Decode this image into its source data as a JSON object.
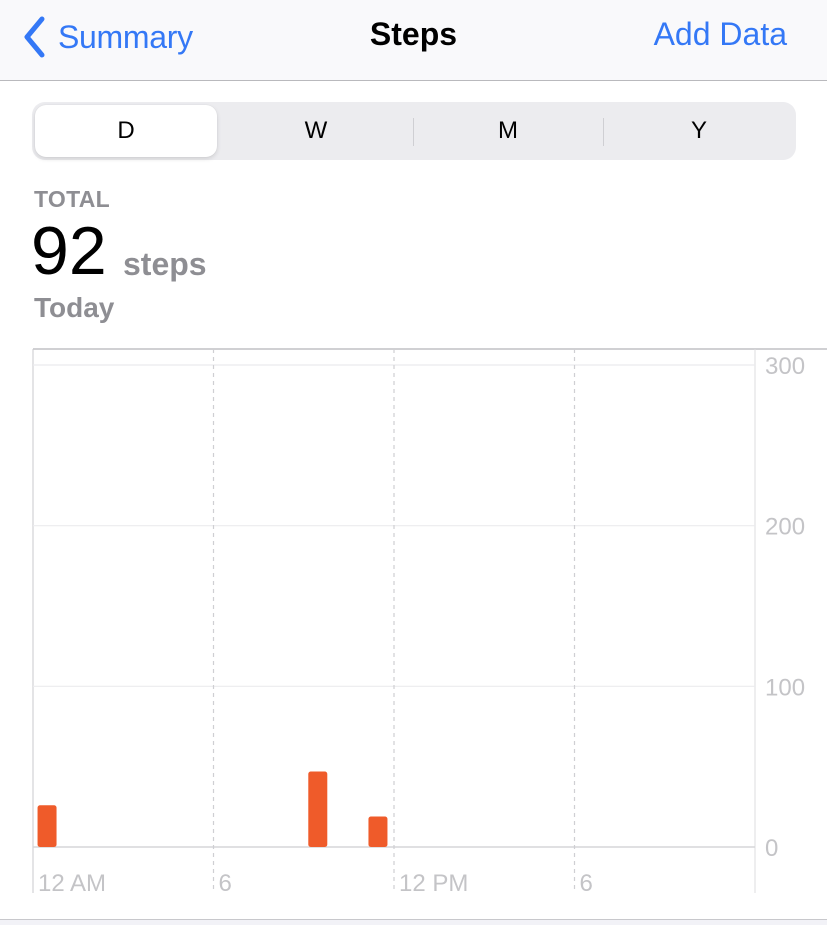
{
  "navbar": {
    "back_label": "Summary",
    "title": "Steps",
    "action_label": "Add Data",
    "accent_color": "#3478f6"
  },
  "segments": {
    "items": [
      "D",
      "W",
      "M",
      "Y"
    ],
    "selected": "D"
  },
  "summary": {
    "label": "TOTAL",
    "value": "92",
    "unit": "steps",
    "period": "Today"
  },
  "chart_data": {
    "type": "bar",
    "title": "",
    "xlabel": "",
    "ylabel": "",
    "x_domain_hours": [
      0,
      24
    ],
    "x_ticks": [
      {
        "hour": 0,
        "label": "12 AM"
      },
      {
        "hour": 6,
        "label": "6"
      },
      {
        "hour": 12,
        "label": "12 PM"
      },
      {
        "hour": 18,
        "label": "6"
      }
    ],
    "ylim": [
      0,
      300
    ],
    "y_ticks": [
      0,
      100,
      200,
      300
    ],
    "grid": true,
    "bar_color": "#ef5b2a",
    "series": [
      {
        "name": "Steps",
        "points": [
          {
            "hour": 0,
            "value": 26
          },
          {
            "hour": 9,
            "value": 47
          },
          {
            "hour": 11,
            "value": 19
          }
        ]
      }
    ]
  }
}
